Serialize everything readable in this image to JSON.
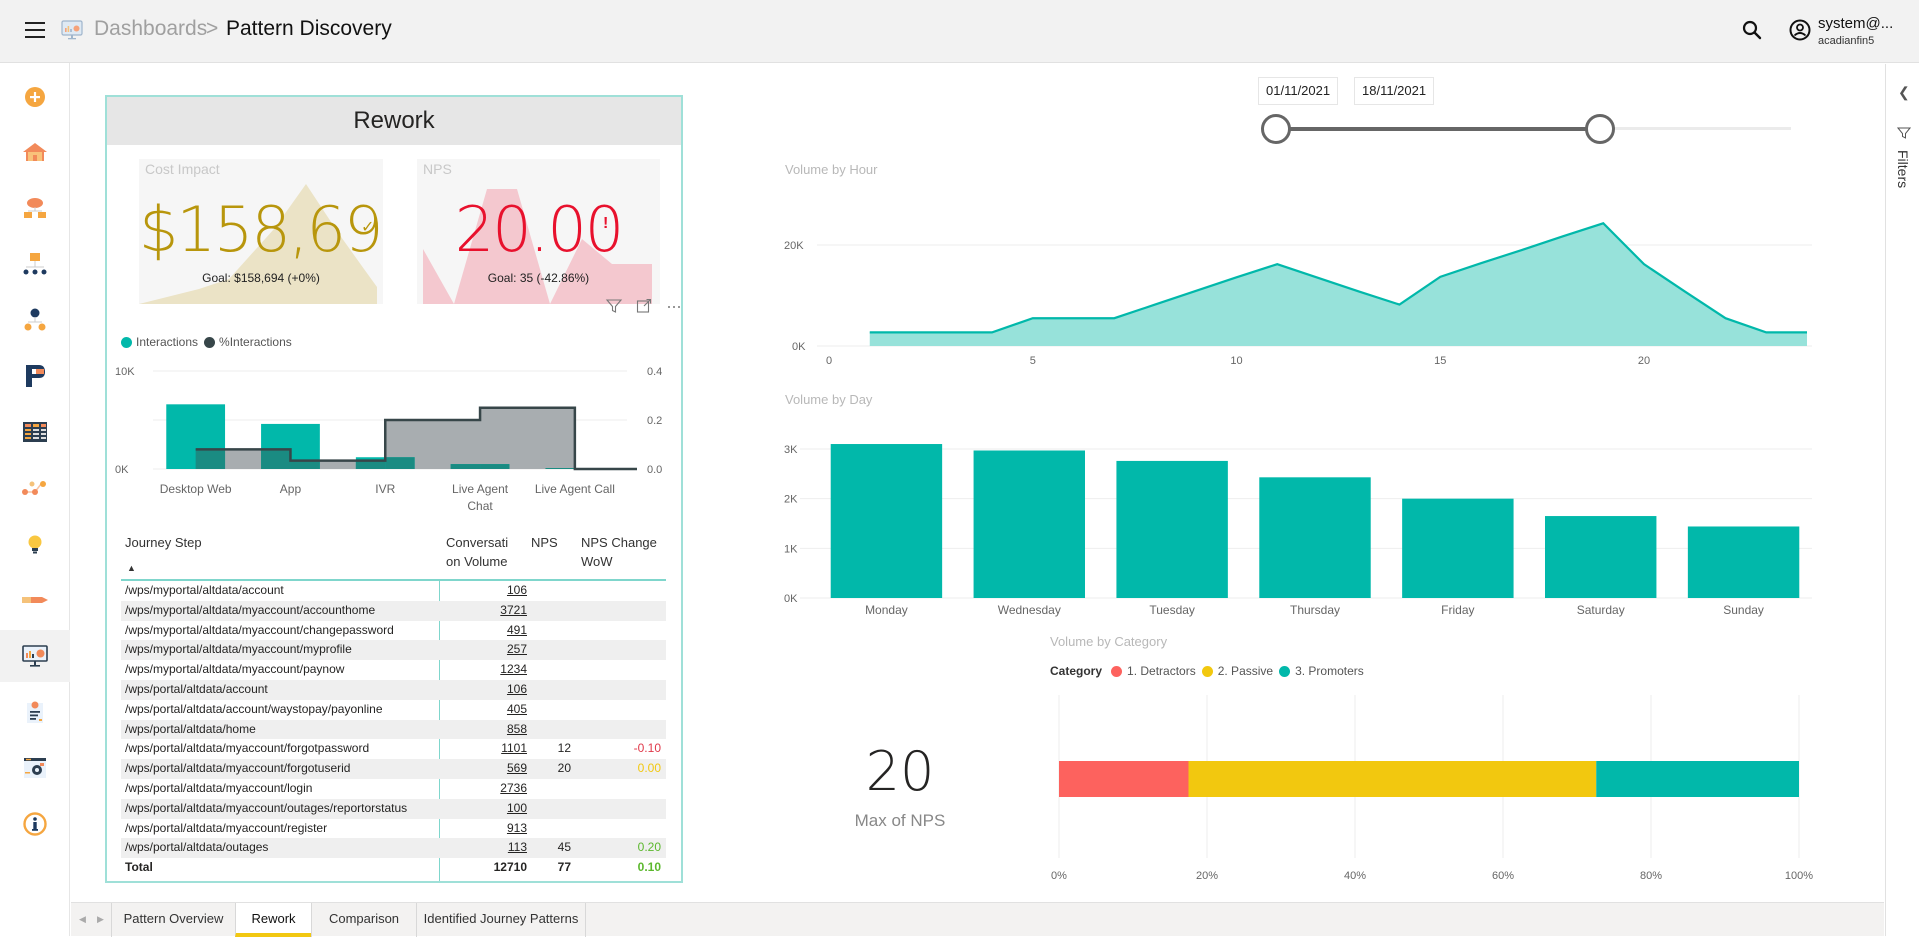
{
  "header": {
    "menu_icon": "hamburger-icon",
    "breadcrumb_parent": "Dashboards",
    "breadcrumb_separator": ">",
    "page_title": "Pattern Discovery",
    "user_name": "system@...",
    "user_org": "acadianfin5"
  },
  "sidebar": {
    "items": [
      {
        "icon": "add-icon",
        "active": false
      },
      {
        "icon": "home-icon",
        "active": false
      },
      {
        "icon": "cloud-folders-icon",
        "active": false
      },
      {
        "icon": "hierarchy-icon",
        "active": false
      },
      {
        "icon": "org-chart-icon",
        "active": false
      },
      {
        "icon": "p-logo-icon",
        "active": false
      },
      {
        "icon": "table-icon",
        "active": false
      },
      {
        "icon": "nodes-icon",
        "active": false
      },
      {
        "icon": "lightbulb-icon",
        "active": false
      },
      {
        "icon": "pencil-icon",
        "active": false
      },
      {
        "icon": "dashboard-monitor-icon",
        "active": true
      },
      {
        "icon": "report-document-icon",
        "active": false
      },
      {
        "icon": "settings-window-icon",
        "active": false
      },
      {
        "icon": "info-icon",
        "active": false
      }
    ]
  },
  "rework": {
    "title": "Rework",
    "cost_impact": {
      "title": "Cost Impact",
      "value": "$158,694",
      "goal": "Goal: $158,694 (+0%)",
      "status": "check",
      "color": "#b8960c"
    },
    "nps": {
      "title": "NPS",
      "value": "20.00",
      "goal": "Goal: 35 (-42.86%)",
      "status": "!",
      "color": "#e8112d"
    }
  },
  "channel_chart": {
    "legend": [
      "Interactions",
      "%Interactions"
    ]
  },
  "journey_table": {
    "headers": {
      "step": "Journey Step",
      "volume_line1": "Conversati",
      "volume_line2": "on Volume",
      "nps": "NPS",
      "change_line1": "NPS Change",
      "change_line2": "WoW",
      "sort_indicator": "▲"
    },
    "rows": [
      {
        "step": "/wps/myportal/altdata/account",
        "volume": "106",
        "nps": "",
        "change": "",
        "change_color": ""
      },
      {
        "step": "/wps/myportal/altdata/myaccount/accounthome",
        "volume": "3721",
        "nps": "",
        "change": "",
        "change_color": ""
      },
      {
        "step": "/wps/myportal/altdata/myaccount/changepassword",
        "volume": "491",
        "nps": "",
        "change": "",
        "change_color": ""
      },
      {
        "step": "/wps/myportal/altdata/myaccount/myprofile",
        "volume": "257",
        "nps": "",
        "change": "",
        "change_color": ""
      },
      {
        "step": "/wps/myportal/altdata/myaccount/paynow",
        "volume": "1234",
        "nps": "",
        "change": "",
        "change_color": ""
      },
      {
        "step": "/wps/portal/altdata/account",
        "volume": "106",
        "nps": "",
        "change": "",
        "change_color": ""
      },
      {
        "step": "/wps/portal/altdata/account/waystopay/payonline",
        "volume": "405",
        "nps": "",
        "change": "",
        "change_color": ""
      },
      {
        "step": "/wps/portal/altdata/home",
        "volume": "858",
        "nps": "",
        "change": "",
        "change_color": ""
      },
      {
        "step": "/wps/portal/altdata/myaccount/forgotpassword",
        "volume": "1101",
        "nps": "12",
        "change": "-0.10",
        "change_color": "#e0394a"
      },
      {
        "step": "/wps/portal/altdata/myaccount/forgotuserid",
        "volume": "569",
        "nps": "20",
        "change": "0.00",
        "change_color": "#f2c811"
      },
      {
        "step": "/wps/portal/altdata/myaccount/login",
        "volume": "2736",
        "nps": "",
        "change": "",
        "change_color": ""
      },
      {
        "step": "/wps/portal/altdata/myaccount/outages/reportorstatus",
        "volume": "100",
        "nps": "",
        "change": "",
        "change_color": ""
      },
      {
        "step": "/wps/portal/altdata/myaccount/register",
        "volume": "913",
        "nps": "",
        "change": "",
        "change_color": ""
      },
      {
        "step": "/wps/portal/altdata/outages",
        "volume": "113",
        "nps": "45",
        "change": "0.20",
        "change_color": "#5cb82e"
      }
    ],
    "total": {
      "step": "Total",
      "volume": "12710",
      "nps": "77",
      "change": "0.10",
      "change_color": "#5cb82e"
    }
  },
  "date_filter": {
    "start": "01/11/2021",
    "end": "18/11/2021",
    "range_fraction": [
      0.0,
      0.63
    ]
  },
  "filters_pane": {
    "label": "Filters",
    "collapse_icon": "chevron-left-icon"
  },
  "kpi_card": {
    "value": "20",
    "label": "Max of NPS"
  },
  "tabs": {
    "items": [
      {
        "label": "Pattern Overview",
        "active": false
      },
      {
        "label": "Rework",
        "active": true
      },
      {
        "label": "Comparison",
        "active": false
      },
      {
        "label": "Identified Journey Patterns",
        "active": false
      }
    ]
  },
  "colors": {
    "teal": "#01b8aa",
    "teal_fill": "#97e2da",
    "dark": "#374649",
    "grey_area": "#a8adb0",
    "detractors": "#fd625e",
    "passive": "#f2c80f",
    "promoters": "#01b8aa"
  },
  "chart_data": [
    {
      "id": "channel_combo",
      "type": "bar",
      "title": "",
      "categories": [
        "Desktop Web",
        "App",
        "IVR",
        "Live Agent Chat",
        "Live Agent Call"
      ],
      "series": [
        {
          "name": "Interactions",
          "axis": "left",
          "values": [
            6600,
            4600,
            1200,
            500,
            100
          ]
        },
        {
          "name": "%Interactions",
          "axis": "right",
          "kind": "step-area",
          "values": [
            0.08,
            0.034,
            0.2,
            0.25,
            0.0
          ]
        }
      ],
      "y_ticks_left": [
        "0K",
        "10K"
      ],
      "y_ticks_right": [
        "0.0",
        "0.2",
        "0.4"
      ],
      "ylim_left": [
        0,
        10000
      ],
      "ylim_right": [
        0,
        0.4
      ],
      "legend": "top-left"
    },
    {
      "id": "volume_by_hour",
      "type": "area",
      "title": "Volume by Hour",
      "x": [
        1,
        2,
        3,
        4,
        5,
        6,
        7,
        8,
        9,
        10,
        11,
        12,
        13,
        14,
        15,
        16,
        17,
        18,
        19,
        20,
        21,
        22,
        23,
        24
      ],
      "values": [
        2700,
        2700,
        2700,
        2700,
        5500,
        5500,
        5500,
        8200,
        10900,
        13600,
        16200,
        13500,
        10800,
        8200,
        13700,
        16400,
        19000,
        21700,
        24300,
        16200,
        10800,
        5500,
        2700,
        2700
      ],
      "x_ticks": [
        "0",
        "5",
        "10",
        "15",
        "20"
      ],
      "y_ticks": [
        "0K",
        "20K"
      ],
      "xlim": [
        0,
        24
      ],
      "ylim": [
        0,
        27000
      ],
      "grid": true
    },
    {
      "id": "volume_by_day",
      "type": "bar",
      "title": "Volume by Day",
      "categories": [
        "Monday",
        "Wednesday",
        "Tuesday",
        "Thursday",
        "Friday",
        "Saturday",
        "Sunday"
      ],
      "values": [
        3100,
        2970,
        2760,
        2430,
        2000,
        1650,
        1440
      ],
      "y_ticks": [
        "0K",
        "1K",
        "2K",
        "3K"
      ],
      "ylim": [
        0,
        3300
      ],
      "grid": true
    },
    {
      "id": "volume_by_category",
      "type": "bar",
      "orientation": "horizontal-stacked-100",
      "title": "Volume by Category",
      "legend_title": "Category",
      "series": [
        {
          "name": "1. Detractors",
          "value": 17.5
        },
        {
          "name": "2. Passive",
          "value": 55.1
        },
        {
          "name": "3. Promoters",
          "value": 27.4
        }
      ],
      "x_ticks": [
        "0%",
        "20%",
        "40%",
        "60%",
        "80%",
        "100%"
      ],
      "xlim": [
        0,
        100
      ],
      "legend": "top-left"
    }
  ]
}
